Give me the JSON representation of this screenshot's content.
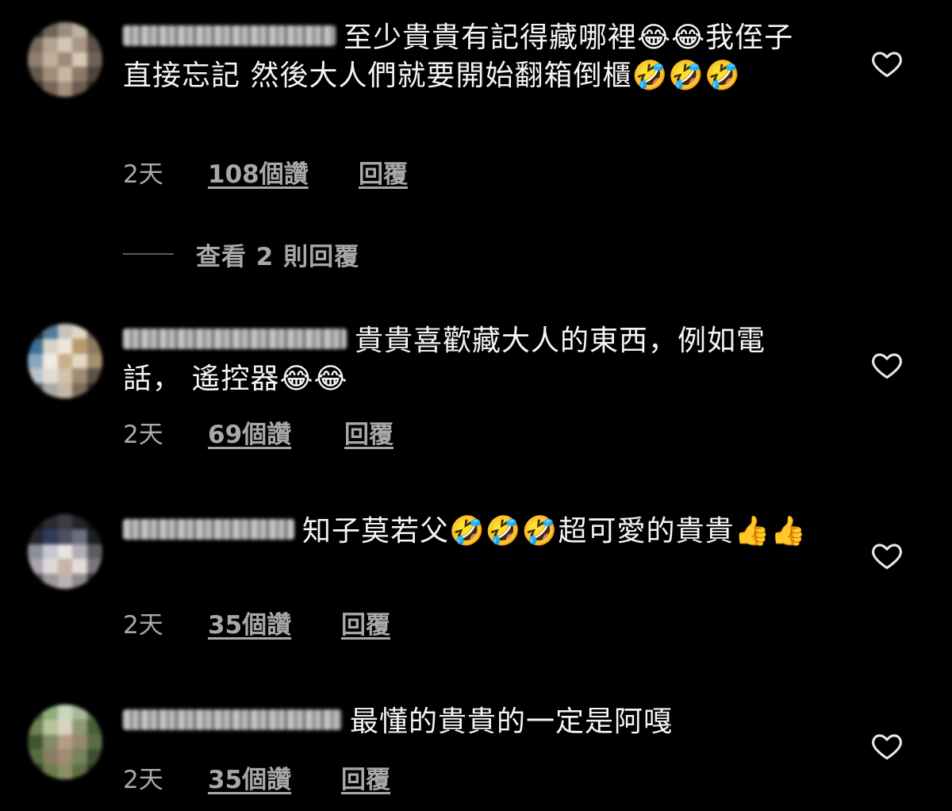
{
  "comments": [
    {
      "text": "至少貴貴有記得藏哪裡😂😂我侄子直接忘記 然後大人們就要開始翻箱倒櫃🤣🤣🤣",
      "time": "2天",
      "likes": "108個讚",
      "reply": "回覆"
    },
    {
      "text": "貴貴喜歡藏大人的東西，例如電話， 遙控器😂😂",
      "time": "2天",
      "likes": "69個讚",
      "reply": "回覆"
    },
    {
      "text": "知子莫若父🤣🤣🤣超可愛的貴貴👍👍",
      "time": "2天",
      "likes": "35個讚",
      "reply": "回覆"
    },
    {
      "text": "最懂的貴貴的一定是阿嘎",
      "time": "2天",
      "likes": "35個讚",
      "reply": "回覆"
    }
  ],
  "view_replies": "查看 2 則回覆",
  "colors": {
    "background": "#000000",
    "text": "#f5f5f5",
    "meta": "#a8a8a8",
    "divider": "#5c5c5c"
  },
  "icons": {
    "like": "heart-outline-icon"
  }
}
